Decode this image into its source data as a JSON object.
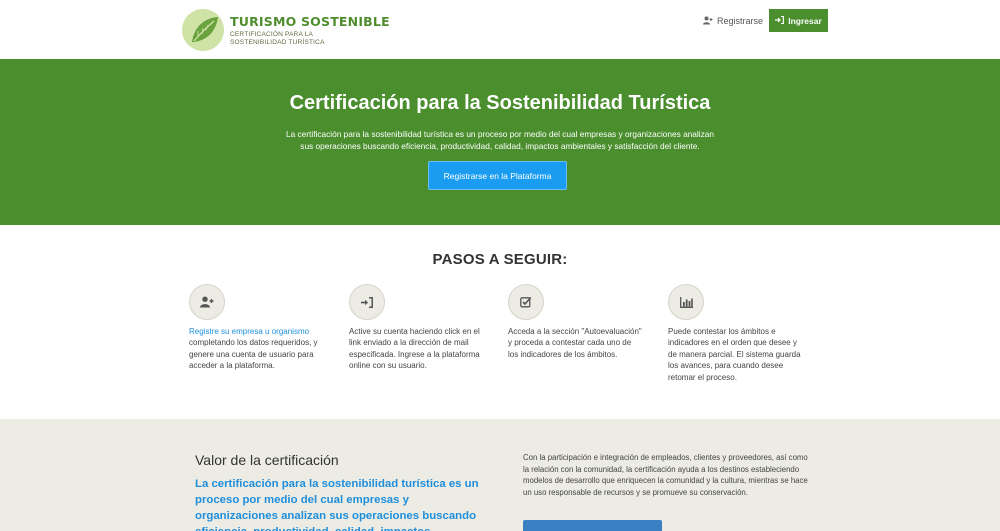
{
  "header": {
    "logo_title": "TURISMO SOSTENIBLE",
    "logo_sub_line1": "CERTIFICACIÓN PARA LA",
    "logo_sub_line2": "SOSTENIBILIDAD TURÍSTICA",
    "register_label": "Registrarse",
    "login_label": "Ingresar"
  },
  "hero": {
    "title": "Certificación para la Sostenibilidad Turística",
    "description": "La certificación para la sostenibilidad turística es un proceso por medio del cual empresas y organizaciones analizan sus operaciones buscando eficiencia, productividad, calidad, impactos ambientales y satisfacción del cliente.",
    "button_label": "Registrarse en la Plataforma"
  },
  "steps": {
    "title": "PASOS A SEGUIR:",
    "items": [
      {
        "icon": "user-plus-icon",
        "link": "Registre su empresa u organismo",
        "text": " completando los datos requeridos, y genere una cuenta de usuario para acceder a la plataforma."
      },
      {
        "icon": "sign-in-icon",
        "link": "",
        "text": "Active su cuenta haciendo click en el link enviado a la dirección de mail especificada. Ingrese a la plataforma online con su usuario."
      },
      {
        "icon": "checkbox-icon",
        "link": "",
        "text": "Acceda a la sección \"Autoevaluación\" y proceda a contestar cada uno de los indicadores de los ámbitos."
      },
      {
        "icon": "bar-chart-icon",
        "link": "",
        "text": "Puede contestar los ámbitos e indicadores en el orden que desee y de manera parcial. El sistema guarda los avances, para cuando desee retomar el proceso."
      }
    ]
  },
  "value": {
    "title": "Valor de la certificación",
    "lead": "La certificación para la sostenibilidad turística es un proceso por medio del cual empresas y organizaciones analizan sus operaciones buscando eficiencia, productividad, calidad, impactos ambientales y",
    "right_text": "Con la participación e integración de empleados, clientes y proveedores, así como la relación con la comunidad, la certificación ayuda a los destinos estableciendo modelos de desarrollo que enriquecen la comunidad y la cultura, mientras se hace un uso responsable de recursos y se promueve su conservación."
  },
  "colors": {
    "brand_green": "#4a8e2e",
    "accent_blue": "#1a9df0",
    "link_blue": "#1f8fdc",
    "section_gray": "#ecebe4"
  }
}
